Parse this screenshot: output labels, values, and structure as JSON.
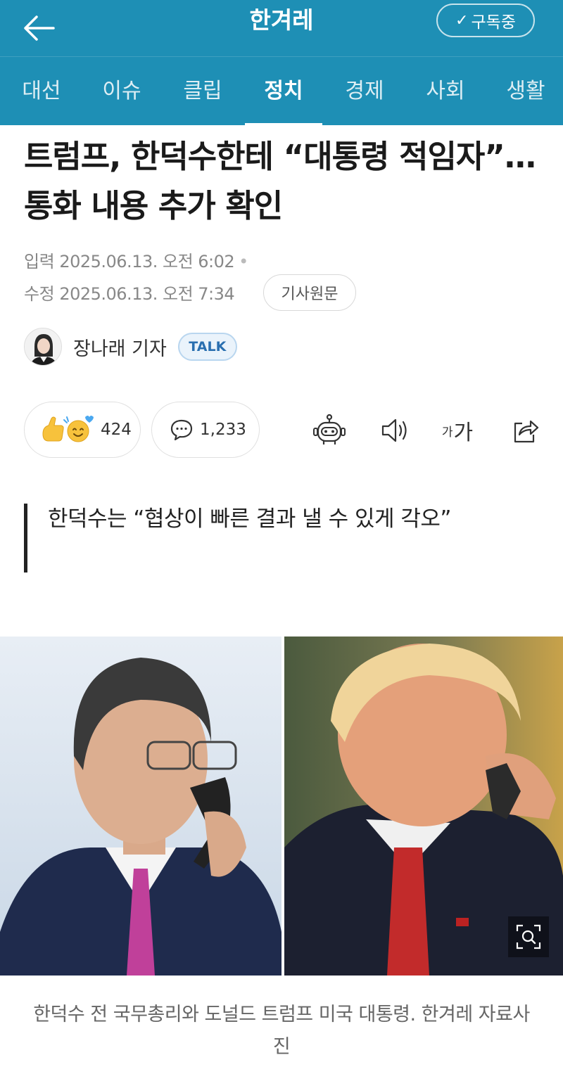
{
  "header": {
    "brand": "한겨레",
    "subscribe_label": "구독중",
    "subscribe_icon": "check-icon",
    "back_icon": "arrow-left-icon",
    "color": "#1e8fb5"
  },
  "nav": {
    "tabs": [
      {
        "label": "대선"
      },
      {
        "label": "이슈"
      },
      {
        "label": "클립"
      },
      {
        "label": "정치"
      },
      {
        "label": "경제"
      },
      {
        "label": "사회"
      },
      {
        "label": "생활"
      }
    ],
    "active": "정치"
  },
  "article": {
    "headline": "트럼프, 한덕수한테 “대통령 적임자”…통화 내용 추가 확인",
    "input_label": "입력",
    "input_date": "2025.06.13. 오전 6:02",
    "modified_label": "수정",
    "modified_date": "2025.06.13. 오전 7:34",
    "original_button": "기사원문",
    "author": "장나래 기자",
    "talk_label": "TALK",
    "reactions_count": "424",
    "comments_count": "1,233",
    "fontsize_small": "가",
    "fontsize_large": "가",
    "quote": "한덕수는 “협상이 빠른 결과 낼 수 있게 각오”",
    "caption": "한덕수 전 국무총리와 도널드 트럼프 미국 대통령. 한겨레 자료사진"
  },
  "icons": {
    "reaction": "reaction-emoji-icon",
    "comment": "comment-bubble-icon",
    "summary": "robot-summary-icon",
    "audio": "speaker-icon",
    "share": "share-icon",
    "zoom": "zoom-icon"
  }
}
